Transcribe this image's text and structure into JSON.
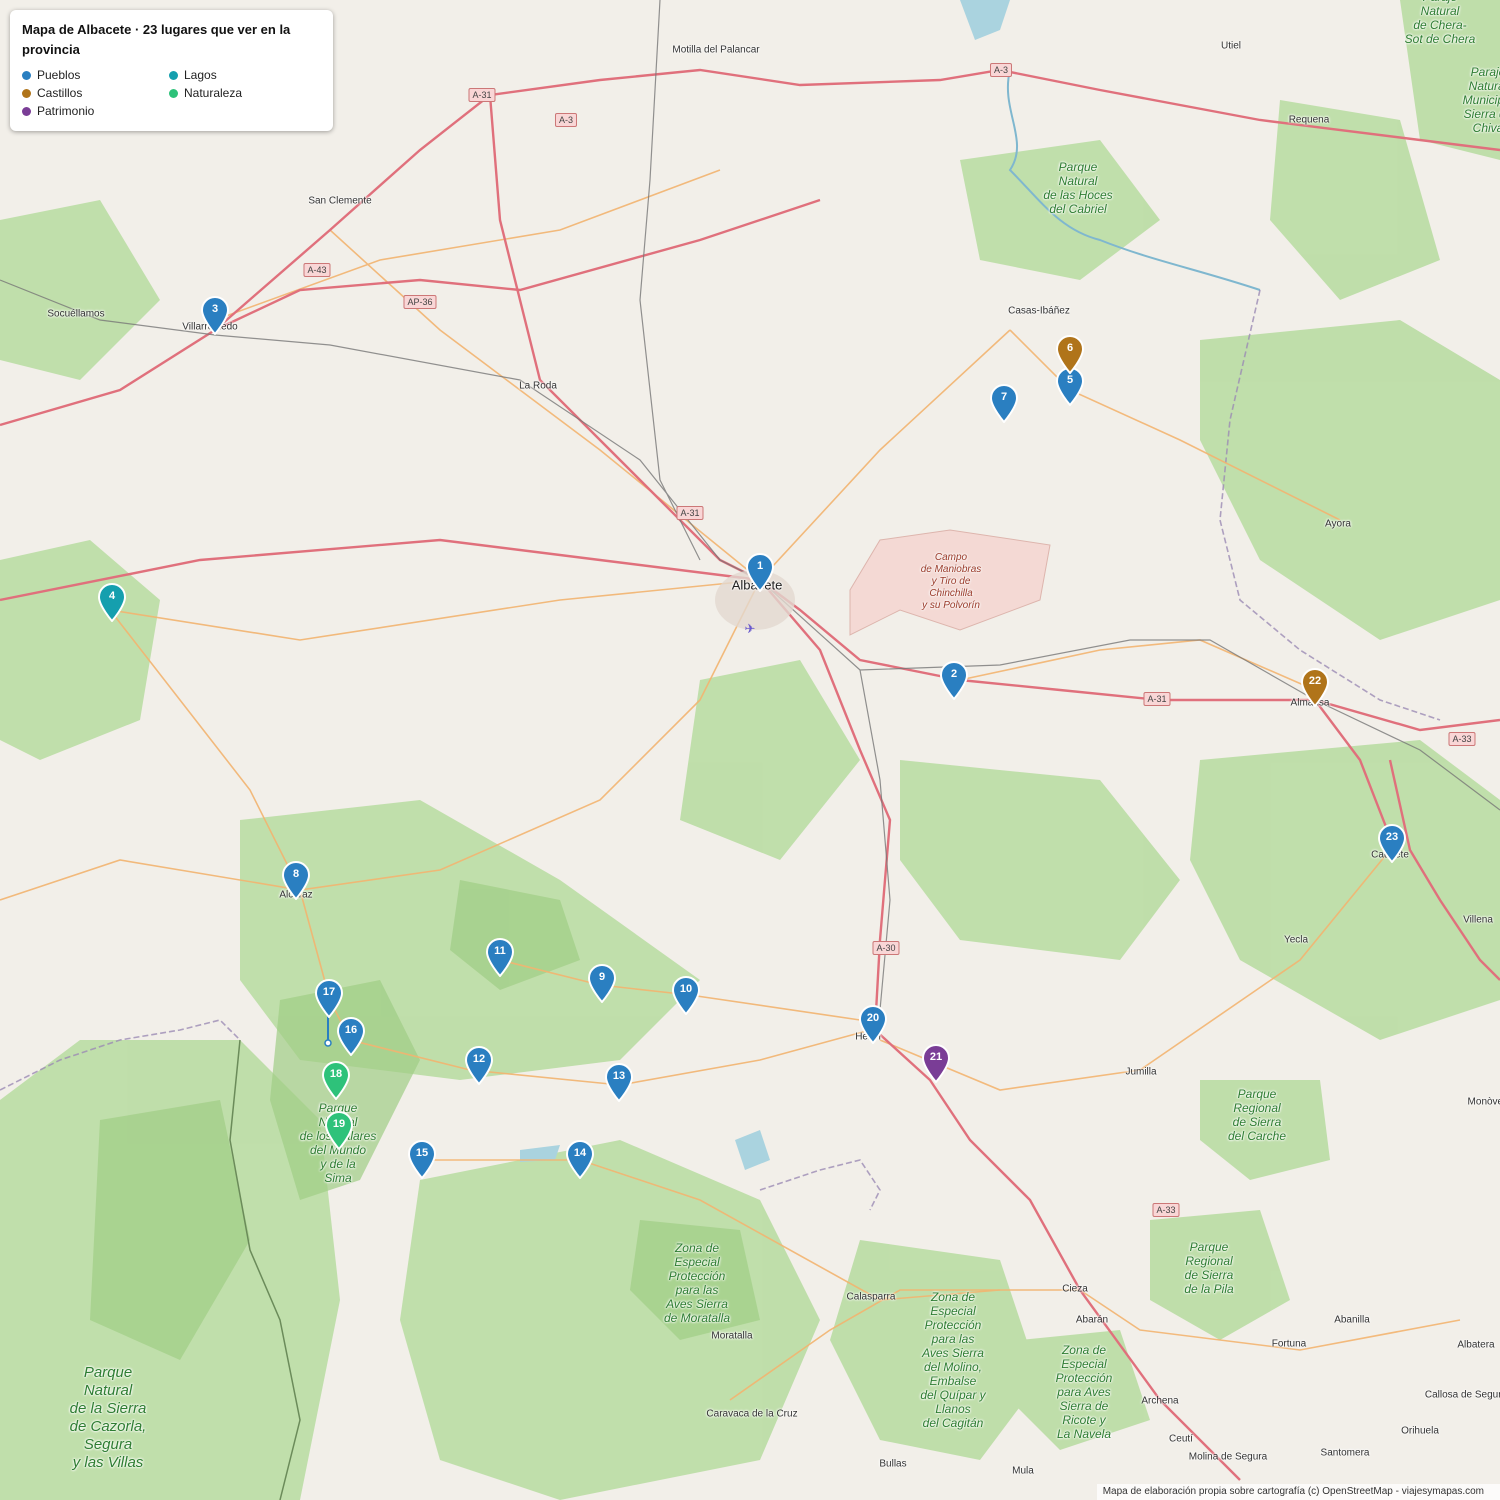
{
  "legend": {
    "title": "Mapa de Albacete · 23 lugares que ver en la provincia",
    "items": [
      {
        "label": "Pueblos",
        "color": "#2a7fc1"
      },
      {
        "label": "Lagos",
        "color": "#159fae"
      },
      {
        "label": "Castillos",
        "color": "#b0741a"
      },
      {
        "label": "Naturaleza",
        "color": "#2ec27a"
      },
      {
        "label": "Patrimonio",
        "color": "#7a3d96"
      }
    ]
  },
  "markers": [
    {
      "n": "1",
      "category": "Pueblos"
    },
    {
      "n": "2",
      "category": "Pueblos"
    },
    {
      "n": "3",
      "category": "Pueblos"
    },
    {
      "n": "4",
      "category": "Lagos"
    },
    {
      "n": "5",
      "category": "Pueblos"
    },
    {
      "n": "6",
      "category": "Castillos"
    },
    {
      "n": "7",
      "category": "Pueblos"
    },
    {
      "n": "8",
      "category": "Pueblos"
    },
    {
      "n": "9",
      "category": "Pueblos"
    },
    {
      "n": "10",
      "category": "Pueblos"
    },
    {
      "n": "11",
      "category": "Pueblos"
    },
    {
      "n": "12",
      "category": "Pueblos"
    },
    {
      "n": "13",
      "category": "Pueblos"
    },
    {
      "n": "14",
      "category": "Pueblos"
    },
    {
      "n": "15",
      "category": "Pueblos"
    },
    {
      "n": "16",
      "category": "Pueblos"
    },
    {
      "n": "17",
      "category": "Pueblos"
    },
    {
      "n": "18",
      "category": "Naturaleza"
    },
    {
      "n": "19",
      "category": "Naturaleza"
    },
    {
      "n": "20",
      "category": "Pueblos"
    },
    {
      "n": "21",
      "category": "Patrimonio"
    },
    {
      "n": "22",
      "category": "Castillos"
    },
    {
      "n": "23",
      "category": "Pueblos"
    }
  ],
  "places": [
    "Motilla del Palancar",
    "Utiel",
    "Requena",
    "San Clemente",
    "Socuéllamos",
    "Villarrobledo",
    "La Roda",
    "Casas-Ibáñez",
    "Albacete",
    "Ayora",
    "Almansa",
    "Caudete",
    "Villena",
    "Yecla",
    "Jumilla",
    "Hellín",
    "Alcaraz",
    "Calasparra",
    "Cieza",
    "Abarán",
    "Moratalla",
    "Caravaca de la Cruz",
    "Bullas",
    "Mula",
    "Archena",
    "Ceutí",
    "Molina de Segura",
    "Fortuna",
    "Abanilla",
    "Santomera",
    "Orihuela",
    "Albatera",
    "Callosa de Segura",
    "Monòver"
  ],
  "roads": [
    "A-3",
    "A-31",
    "A-43",
    "AP-36",
    "A-30",
    "A-33"
  ],
  "areas": [
    "Parque Natural de las Hoces del Cabriel",
    "Campo de Maniobras y Tiro de Chinchilla y su Polvorín",
    "Parque Natural de los Calares del Mundo y de la Sima",
    "Zona de Especial Protección para las Aves Sierra de Moratalla",
    "Zona de Especial Protección para las Aves Sierra del Molino, Embalse del Quípar y Llanos del Cagitán",
    "Parque Regional de Sierra del Carche",
    "Parque Regional de Sierra de la Pila",
    "Zona de Especial Protección para Aves Sierra de Ricote y La Navela",
    "Parque Natural de la Sierra de Cazorla, Segura y las Villas",
    "Parque Natural de Chera-Sot de Chera",
    "Paraje Natural Municipal Sierra de Chiva"
  ],
  "attribution": "Mapa de elaboración propia sobre cartografía (c) OpenStreetMap - viajesymapas.com"
}
